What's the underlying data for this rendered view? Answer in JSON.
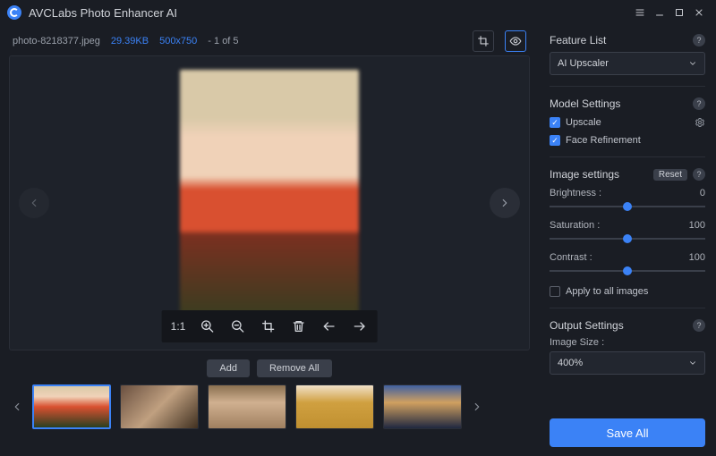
{
  "app": {
    "title": "AVCLabs Photo Enhancer AI"
  },
  "file": {
    "name": "photo-8218377.jpeg",
    "size": "29.39KB",
    "dims": "500x750",
    "index": "- 1 of 5"
  },
  "floatbar": {
    "ratio": "1:1"
  },
  "buttons": {
    "add": "Add",
    "remove_all": "Remove All",
    "save_all": "Save All"
  },
  "feature": {
    "title": "Feature List",
    "selected": "AI Upscaler"
  },
  "model": {
    "title": "Model Settings",
    "upscale": {
      "label": "Upscale",
      "checked": true
    },
    "face": {
      "label": "Face Refinement",
      "checked": true
    }
  },
  "image_settings": {
    "title": "Image settings",
    "reset": "Reset",
    "brightness": {
      "label": "Brightness :",
      "value": "0",
      "pct": 50
    },
    "saturation": {
      "label": "Saturation :",
      "value": "100",
      "pct": 50
    },
    "contrast": {
      "label": "Contrast :",
      "value": "100",
      "pct": 50
    },
    "apply_all": {
      "label": "Apply to all images",
      "checked": false
    }
  },
  "output": {
    "title": "Output Settings",
    "size_label": "Image Size :",
    "size_value": "400%"
  }
}
